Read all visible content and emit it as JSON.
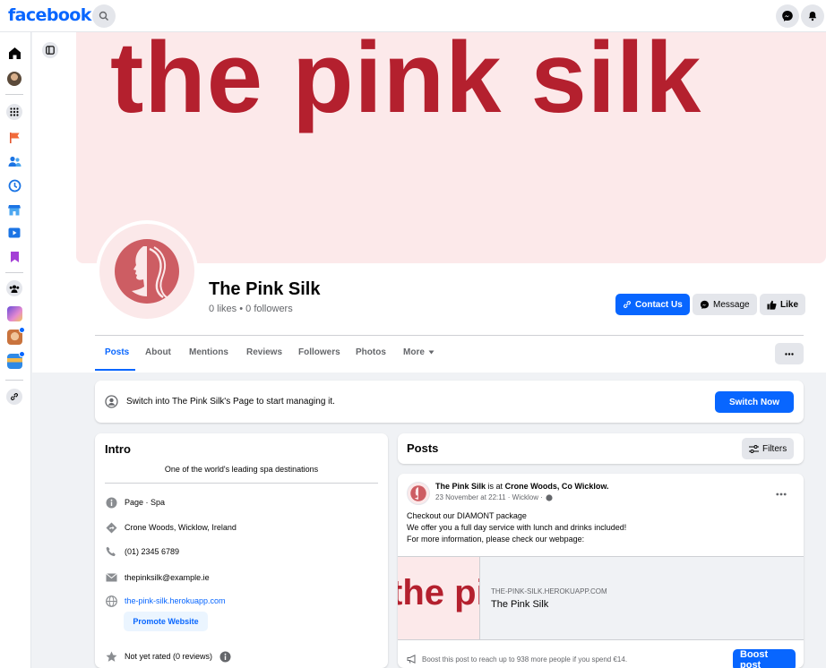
{
  "topbar": {
    "logo": "facebook",
    "icons": [
      "search-icon",
      "messenger-icon",
      "notifications-icon"
    ]
  },
  "rail": {
    "icons": [
      "home-icon",
      "profile-avatar",
      "apps-grid-icon",
      "pages-flag-icon",
      "friends-icon",
      "memories-icon",
      "marketplace-icon",
      "video-icon",
      "saved-icon",
      "groups-icon",
      "group-avatar-1",
      "group-avatar-2",
      "group-avatar-3",
      "link-icon"
    ]
  },
  "cover": {
    "text": "the pink silk",
    "bg_color": "#fce9ea",
    "text_color": "#b4202e"
  },
  "page": {
    "name": "The Pink Silk",
    "stats": "0 likes • 0 followers"
  },
  "actions": {
    "contact": "Contact Us",
    "message": "Message",
    "like": "Like"
  },
  "tabs": [
    "Posts",
    "About",
    "Mentions",
    "Reviews",
    "Followers",
    "Photos",
    "More"
  ],
  "active_tab": "Posts",
  "switch_banner": {
    "text": "Switch into The Pink Silk's Page to start managing it.",
    "button": "Switch Now"
  },
  "intro": {
    "title": "Intro",
    "bio": "One of the world's leading spa destinations",
    "category": "Page · Spa",
    "address": "Crone Woods, Wicklow, Ireland",
    "phone": "(01) 2345 6789",
    "email": "thepinksilk@example.ie",
    "website": "the-pink-silk.herokuapp.com",
    "promote": "Promote Website",
    "rating": "Not yet rated (0 reviews)"
  },
  "posts": {
    "title": "Posts",
    "filters": "Filters"
  },
  "post": {
    "author": "The Pink Silk",
    "is_at": "is at",
    "location": "Crone Woods, Co Wicklow.",
    "meta": "23 November at 22:11 · Wicklow ·",
    "line1": "Checkout our DIAMONT package",
    "line2": "We offer you a full day service with lunch and drinks included!",
    "line3": "For more information, please check our webpage:",
    "preview_text": "the pink silk",
    "link_domain": "THE-PINK-SILK.HEROKUAPP.COM",
    "link_title": "The Pink Silk",
    "boost_text": "Boost this post to reach up to 938 more people if you spend €14.",
    "boost_button": "Boost post"
  },
  "colors": {
    "brand": "#0866ff",
    "accent_red": "#b4202e"
  }
}
